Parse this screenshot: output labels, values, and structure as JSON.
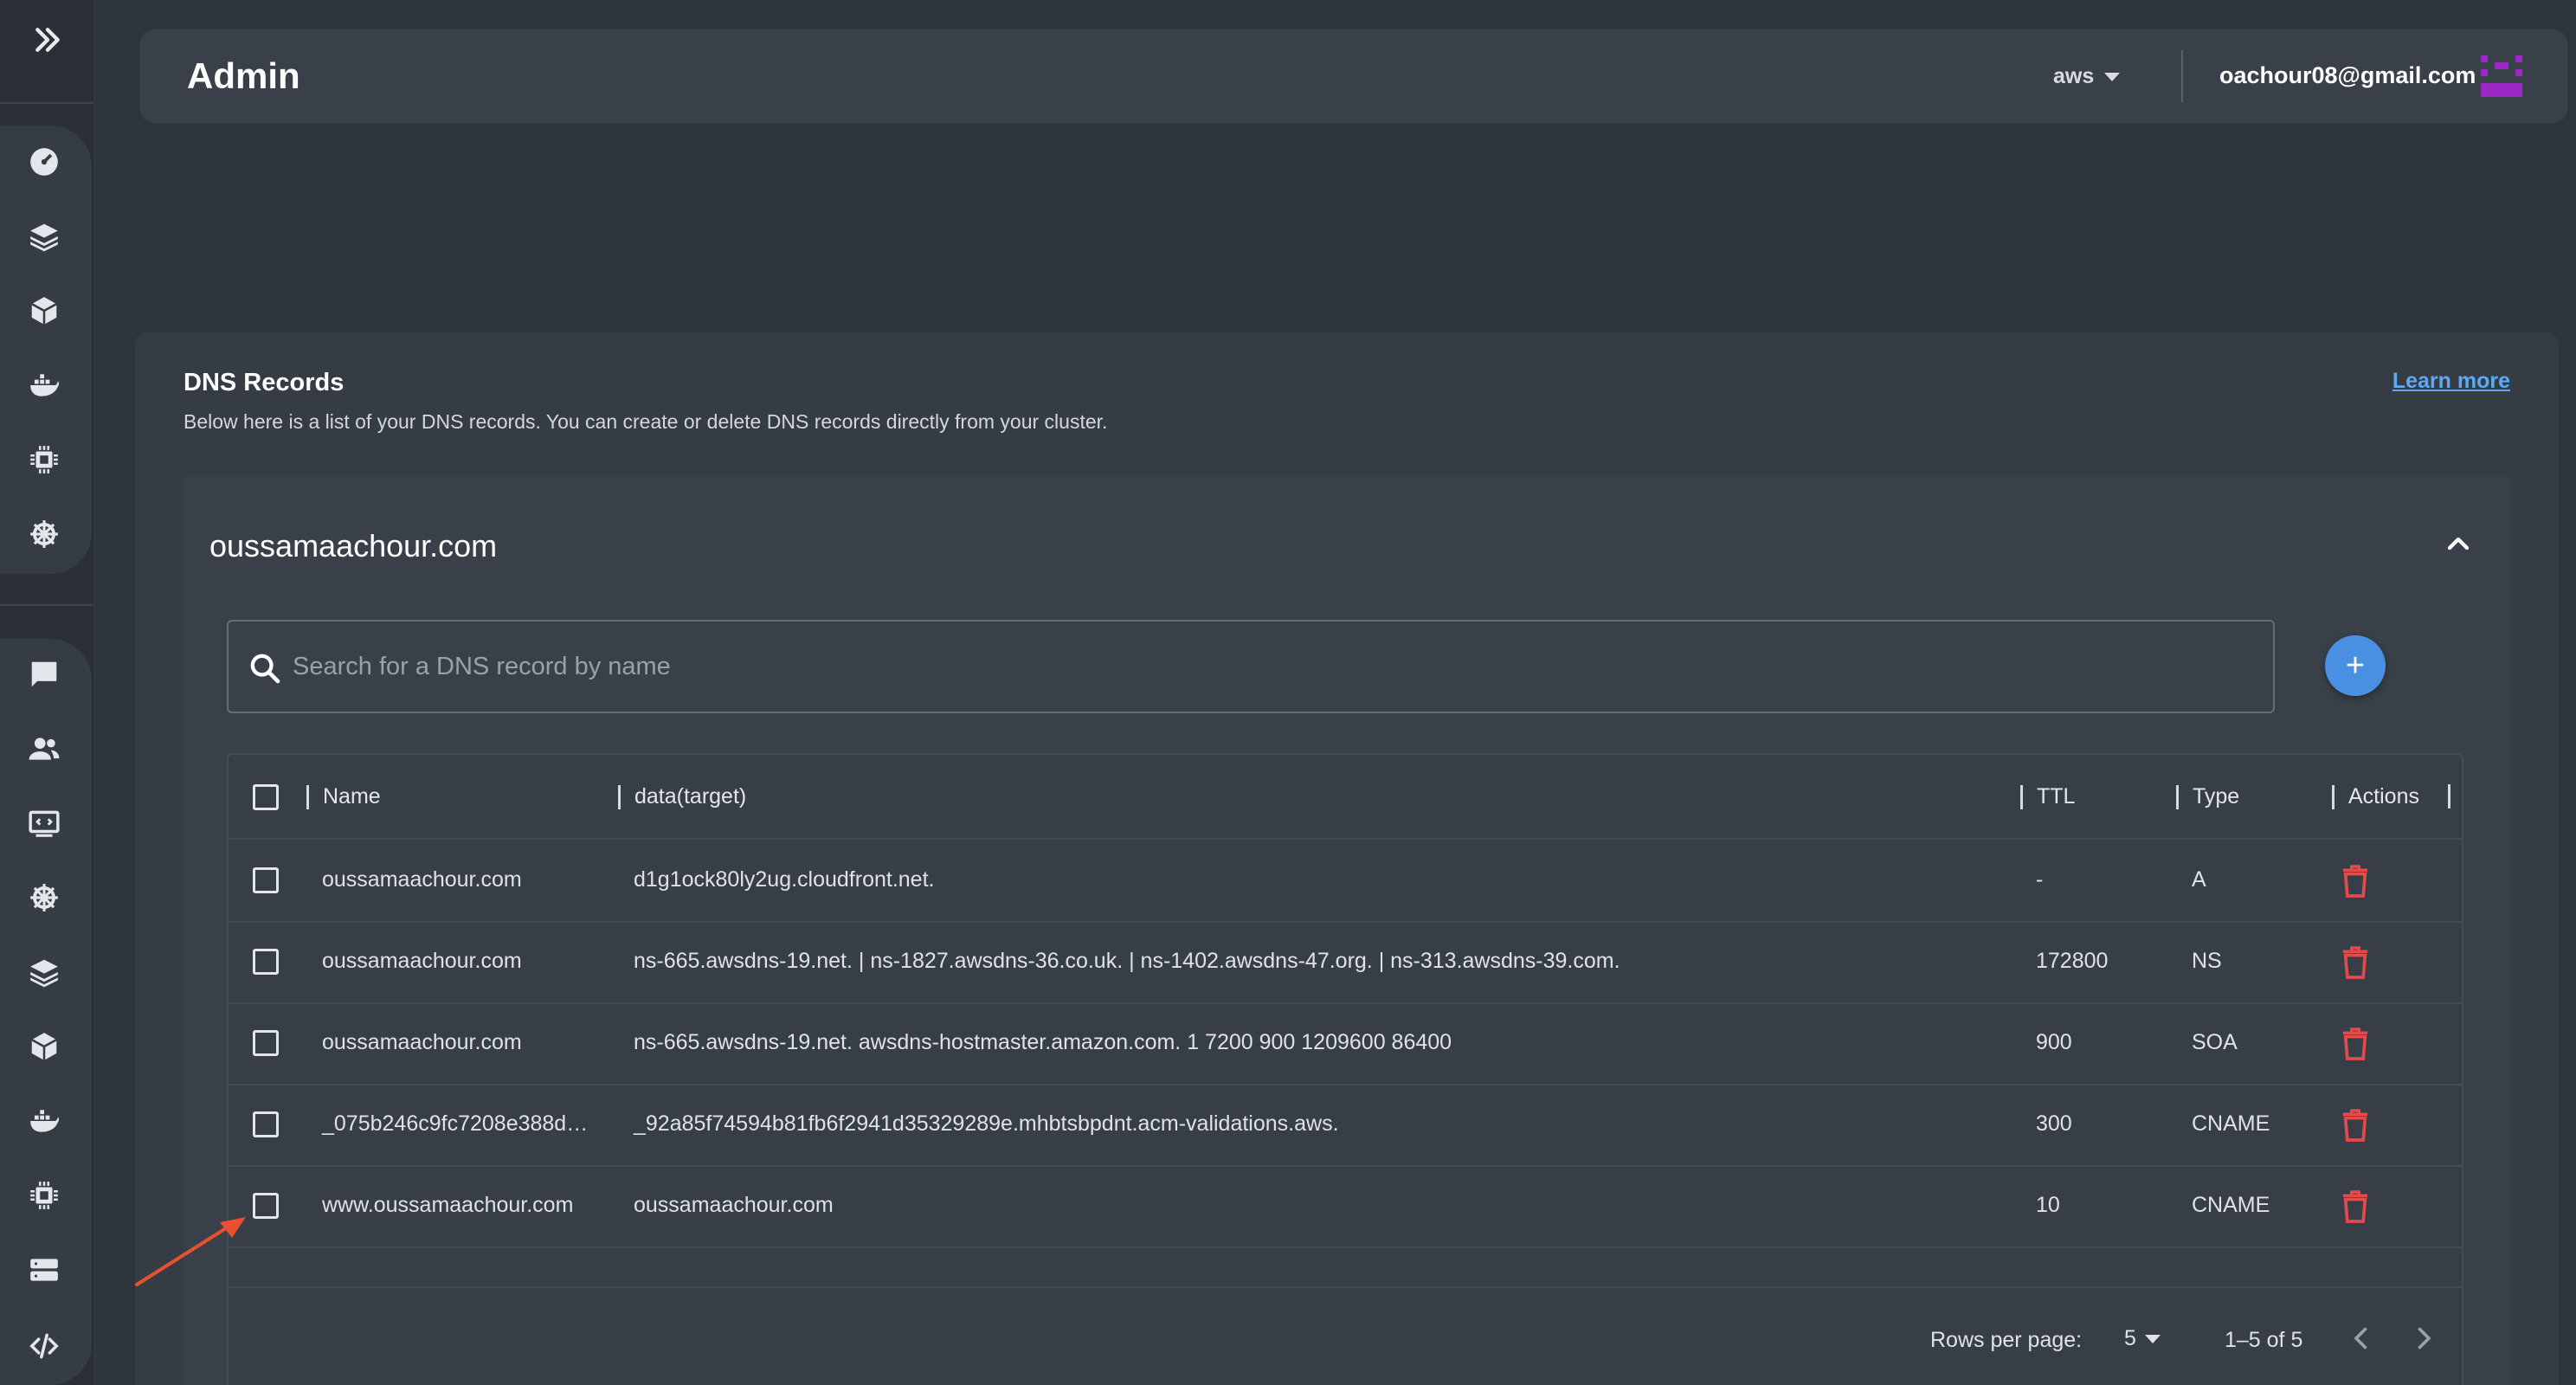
{
  "app": {
    "title": "Admin",
    "cloud_selector": "aws",
    "user_email": "oachour08@gmail.com",
    "accent_color": "#4a90e2",
    "avatar_color": "#9b27c7"
  },
  "sidebar": {
    "toggle_icon": "double-chevron-right-icon",
    "top_icons": [
      "dashboard-icon",
      "layers-icon",
      "cube-icon",
      "docker-icon",
      "chip-icon",
      "helm-icon"
    ],
    "bottom_icons": [
      "chat-icon",
      "users-icon",
      "console-icon",
      "helm-icon",
      "layers-icon",
      "cube-icon",
      "docker-icon",
      "chip-icon",
      "server-icon",
      "code-icon"
    ]
  },
  "dns": {
    "heading": "DNS Records",
    "description": "Below here is a list of your DNS records. You can create or delete DNS records directly from your cluster.",
    "learn_more": "Learn more",
    "zone_name": "oussamaachour.com",
    "search_placeholder": "Search for a DNS record by name",
    "add_button": "+",
    "columns": {
      "name": "Name",
      "data": "data(target)",
      "ttl": "TTL",
      "type": "Type",
      "actions": "Actions"
    },
    "rows": [
      {
        "name": "oussamaachour.com",
        "data": "d1g1ock80ly2ug.cloudfront.net.",
        "ttl": "-",
        "type": "A"
      },
      {
        "name": "oussamaachour.com",
        "data": "ns-665.awsdns-19.net. | ns-1827.awsdns-36.co.uk. | ns-1402.awsdns-47.org. | ns-313.awsdns-39.com.",
        "ttl": "172800",
        "type": "NS"
      },
      {
        "name": "oussamaachour.com",
        "data": "ns-665.awsdns-19.net. awsdns-hostmaster.amazon.com. 1 7200 900 1209600 86400",
        "ttl": "900",
        "type": "SOA"
      },
      {
        "name": "_075b246c9fc7208e388d…",
        "data": "_92a85f74594b81fb6f2941d35329289e.mhbtsbpdnt.acm-validations.aws.",
        "ttl": "300",
        "type": "CNAME"
      },
      {
        "name": "www.oussamaachour.com",
        "data": "oussamaachour.com",
        "ttl": "10",
        "type": "CNAME"
      }
    ],
    "footer": {
      "rows_per_page_label": "Rows per page:",
      "rows_per_page_value": "5",
      "range": "1–5 of 5"
    }
  }
}
